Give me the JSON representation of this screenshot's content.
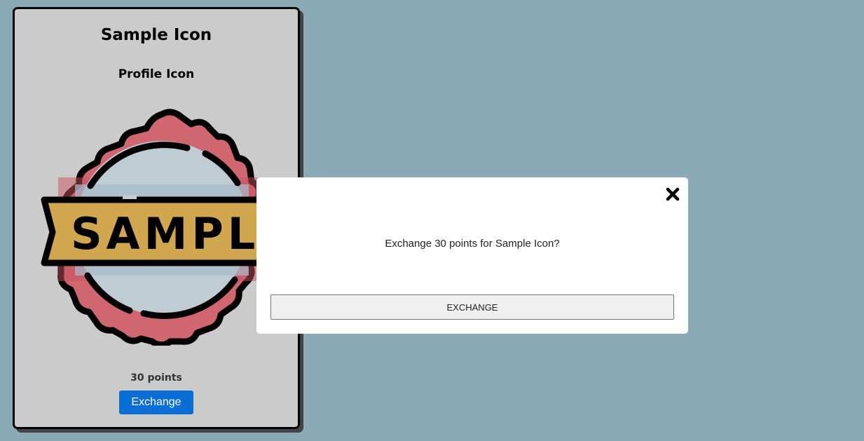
{
  "card": {
    "title": "Sample Icon",
    "subtitle": "Profile Icon",
    "badge_text": "SAMPLE",
    "points": "30 points",
    "button_label": "Exchange"
  },
  "modal": {
    "message": "Exchange 30 points for Sample Icon?",
    "button_label": "EXCHANGE",
    "close_icon": "close-icon"
  },
  "colors": {
    "background": "#8aabb6",
    "card": "#cbcbcb",
    "badge_red": "#cf6670",
    "badge_inner": "#c0ccd3",
    "ribbon": "#d0a64e",
    "primary_button": "#0b6ed4"
  }
}
